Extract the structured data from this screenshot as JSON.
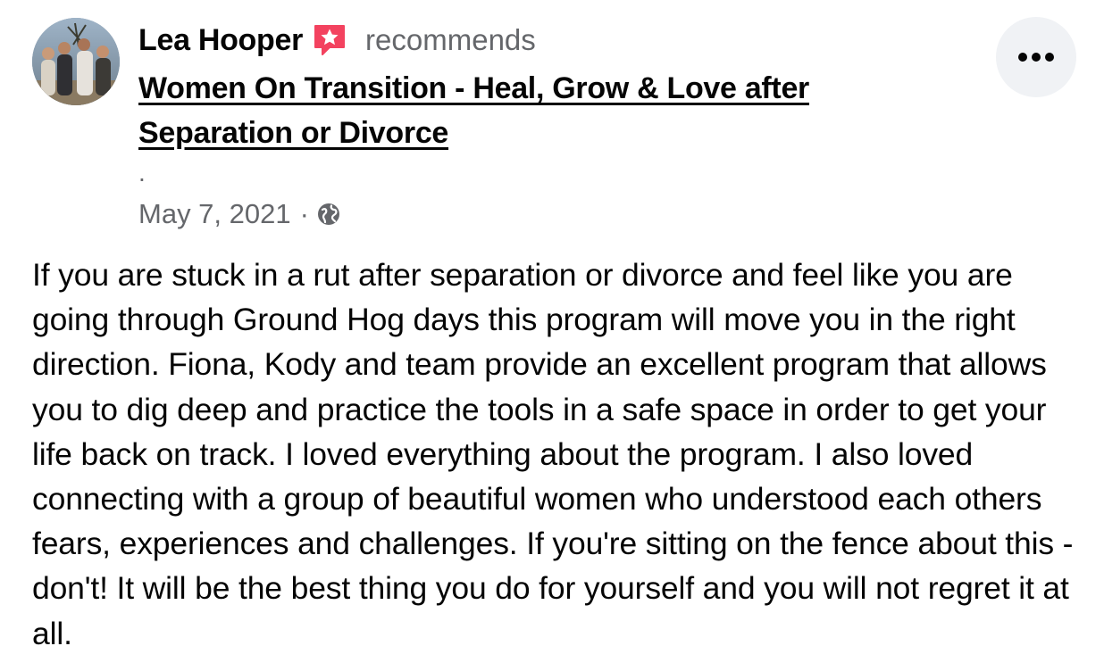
{
  "post": {
    "author_name": "Lea Hooper",
    "action_text": "recommends",
    "recommend_badge_icon": "recommend-star-icon",
    "page_name": "Women On Transition - Heal, Grow & Love after Separation or Divorce",
    "separator": ".",
    "date": "May 7, 2021",
    "meta_separator": "·",
    "privacy_icon": "globe-icon",
    "more_icon": "more-options-icon",
    "body": "If you are stuck in a rut after separation or divorce and feel like you are going through Ground Hog days this program will move you in the right direction. Fiona, Kody and team provide an excellent program that allows you to dig deep and practice the tools in a safe space in order to get your life back on track. I loved everything about the program. I also loved connecting with a group of beautiful women who understood each others fears, experiences and challenges. If you're sitting on the fence about this - don't! It will be the best thing you do for yourself and you will not regret it at all."
  },
  "colors": {
    "badge": "#f3425f",
    "secondary_text": "#65676b",
    "primary_text": "#050505",
    "more_button_bg": "#f0f2f5"
  }
}
